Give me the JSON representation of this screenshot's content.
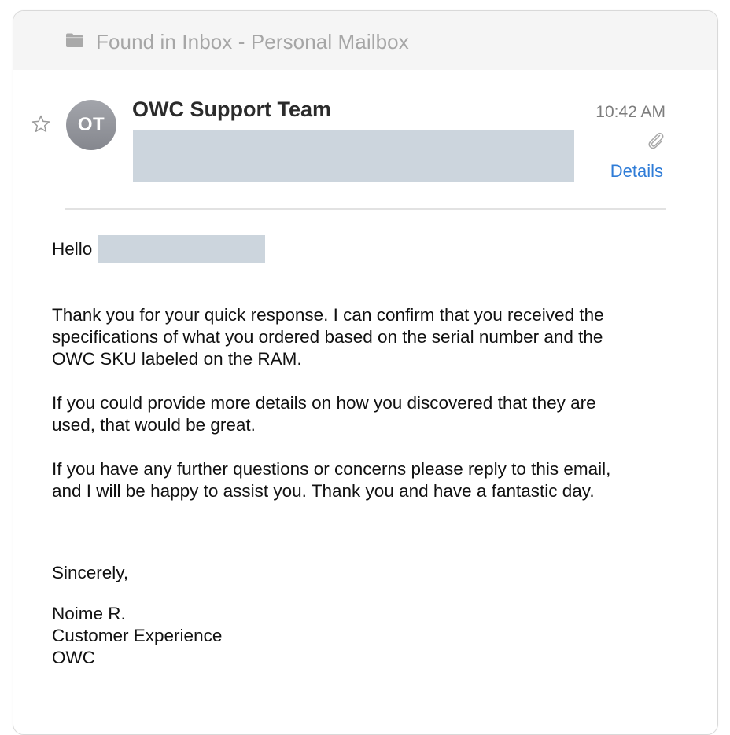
{
  "header": {
    "found_in": "Found in Inbox - Personal Mailbox",
    "folder_icon": "folder-icon"
  },
  "message": {
    "star_icon": "star-icon",
    "avatar_initials": "OT",
    "sender_name": "OWC Support Team",
    "time": "10:42 AM",
    "attachment_icon": "paperclip-icon",
    "details_label": "Details",
    "redaction_color": "#ccd5dd",
    "link_color": "#2f7cd7"
  },
  "body": {
    "greeting": "Hello",
    "para1": [
      "Thank you for your quick response. I can confirm that you received the",
      "specifications of what you ordered based on the serial number and the",
      "OWC SKU labeled on the RAM."
    ],
    "para2": [
      "If you could provide more details on how you discovered that they are",
      "used, that would be great."
    ],
    "para3": [
      "If you have any further questions or concerns please reply to this email,",
      "and I will be happy to assist you. Thank you and have a fantastic day."
    ],
    "closing": "Sincerely,",
    "signature": [
      "Noime R.",
      "Customer Experience",
      "OWC"
    ]
  }
}
